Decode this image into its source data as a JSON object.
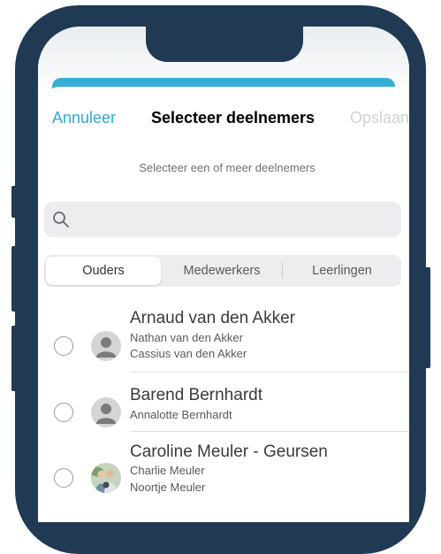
{
  "nav": {
    "cancel_label": "Annuleer",
    "title": "Selecteer deelnemers",
    "save_label": "Opslaan"
  },
  "subtitle": "Selecteer een of meer deelnemers",
  "search": {
    "placeholder": "",
    "icon": "search-icon"
  },
  "segments": [
    {
      "label": "Ouders",
      "active": true
    },
    {
      "label": "Medewerkers",
      "active": false
    },
    {
      "label": "Leerlingen",
      "active": false
    }
  ],
  "list": [
    {
      "name": "Arnaud van den Akker",
      "children": [
        "Nathan van den Akker",
        "Cassius van den Akker"
      ],
      "avatar": "placeholder-person-icon",
      "selected": false
    },
    {
      "name": "Barend Bernhardt",
      "children": [
        "Annalotte Bernhardt"
      ],
      "avatar": "placeholder-person-icon",
      "selected": false
    },
    {
      "name": "Caroline Meuler - Geursen",
      "children": [
        "Charlie Meuler",
        "Noortje Meuler"
      ],
      "avatar": "photo",
      "selected": false
    }
  ],
  "colors": {
    "accent": "#31a9d8",
    "header_strip": "#36aed8",
    "phone_frame": "#1f3a52",
    "disabled_text": "#d2d2d2"
  }
}
